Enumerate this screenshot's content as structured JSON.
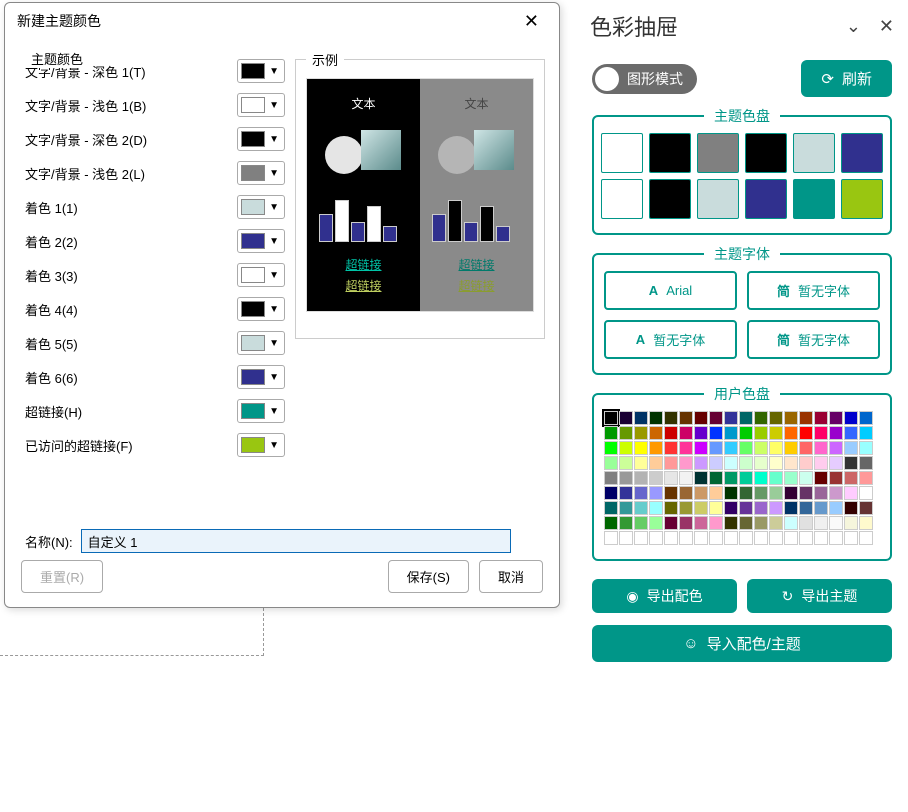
{
  "dialog": {
    "title": "新建主题颜色",
    "group_theme": "主题颜色",
    "group_sample": "示例",
    "rows": [
      {
        "label": "文字/背景 - 深色 1(T)",
        "color": "#000000"
      },
      {
        "label": "文字/背景 - 浅色 1(B)",
        "color": "#FFFFFF"
      },
      {
        "label": "文字/背景 - 深色 2(D)",
        "color": "#000000"
      },
      {
        "label": "文字/背景 - 浅色 2(L)",
        "color": "#808080"
      },
      {
        "label": "着色 1(1)",
        "color": "#C9DCDC"
      },
      {
        "label": "着色 2(2)",
        "color": "#30308E"
      },
      {
        "label": "着色 3(3)",
        "color": "#FFFFFF"
      },
      {
        "label": "着色 4(4)",
        "color": "#000000"
      },
      {
        "label": "着色 5(5)",
        "color": "#C9DCDC"
      },
      {
        "label": "着色 6(6)",
        "color": "#30308E"
      },
      {
        "label": "超链接(H)",
        "color": "#009688"
      },
      {
        "label": "已访问的超链接(F)",
        "color": "#99C611"
      }
    ],
    "sample_text": "文本",
    "sample_link1": "超链接",
    "sample_link2": "超链接",
    "name_label": "名称(N):",
    "name_value": "自定义 1",
    "reset": "重置(R)",
    "save": "保存(S)",
    "cancel": "取消"
  },
  "drawer": {
    "title": "色彩抽屉",
    "mode_label": "图形模式",
    "refresh": "刷新",
    "section_theme": "主题色盘",
    "section_font": "主题字体",
    "section_user": "用户色盘",
    "fonts": [
      "Arial",
      "暂无字体",
      "暂无字体",
      "暂无字体"
    ],
    "theme_colors": [
      "#FFFFFF",
      "#000000",
      "#808080",
      "#000000",
      "#C9DCDC",
      "#30308E",
      "#FFFFFF",
      "#000000",
      "#C9DCDC",
      "#30308E",
      "#009688",
      "#99C611"
    ],
    "user_palette": [
      "#000000",
      "#1a0033",
      "#003366",
      "#003300",
      "#333300",
      "#663300",
      "#660000",
      "#660033",
      "#333399",
      "#006666",
      "#336600",
      "#666600",
      "#996600",
      "#993300",
      "#990033",
      "#660066",
      "#0000cc",
      "#0066cc",
      "#009900",
      "#669900",
      "#999900",
      "#cc6600",
      "#cc0000",
      "#cc0066",
      "#6600cc",
      "#0033ff",
      "#0099cc",
      "#00cc00",
      "#99cc00",
      "#cccc00",
      "#ff6600",
      "#ff0000",
      "#ff0066",
      "#9900cc",
      "#3366ff",
      "#00ccff",
      "#00ff00",
      "#ccff00",
      "#ffff00",
      "#ff9900",
      "#ff3333",
      "#ff3399",
      "#cc00ff",
      "#6699ff",
      "#33ccff",
      "#66ff66",
      "#ccff66",
      "#ffff66",
      "#ffcc00",
      "#ff6666",
      "#ff66cc",
      "#cc66ff",
      "#99ccff",
      "#99ffff",
      "#99ff99",
      "#ccff99",
      "#ffff99",
      "#ffcc99",
      "#ff9999",
      "#ff99cc",
      "#cc99ff",
      "#ccccff",
      "#ccffff",
      "#ccffcc",
      "#e6ffcc",
      "#ffffcc",
      "#ffe6cc",
      "#ffcccc",
      "#ffccee",
      "#e6ccff",
      "#333333",
      "#666666",
      "#808080",
      "#999999",
      "#b3b3b3",
      "#cccccc",
      "#e6e6e6",
      "#f2f2f2",
      "#003333",
      "#006633",
      "#009966",
      "#00cc99",
      "#00ffcc",
      "#66ffcc",
      "#99ffcc",
      "#ccffee",
      "#660000",
      "#993333",
      "#cc6666",
      "#ff9999",
      "#000066",
      "#333399",
      "#6666cc",
      "#9999ff",
      "#663300",
      "#996633",
      "#cc9966",
      "#ffcc99",
      "#003300",
      "#336633",
      "#669966",
      "#99cc99",
      "#330033",
      "#663366",
      "#996699",
      "#cc99cc",
      "#ffccff",
      "#ffffff",
      "#006666",
      "#339999",
      "#66cccc",
      "#99ffff",
      "#666600",
      "#999933",
      "#cccc66",
      "#ffff99",
      "#330066",
      "#663399",
      "#9966cc",
      "#cc99ff",
      "#003366",
      "#336699",
      "#6699cc",
      "#99ccff",
      "#330000",
      "#663333",
      "#006600",
      "#339933",
      "#66cc66",
      "#99ff99",
      "#660033",
      "#993366",
      "#cc6699",
      "#ff99cc",
      "#333300",
      "#666633",
      "#999966",
      "#cccc99",
      "#ccffff",
      "#e0e0e0",
      "#f0f0f0",
      "#fafafa",
      "#f5f5dc",
      "#fffacd",
      "#ffffff",
      "#ffffff",
      "#ffffff",
      "#ffffff",
      "#ffffff",
      "#ffffff",
      "#ffffff",
      "#ffffff",
      "#ffffff",
      "#ffffff",
      "#ffffff",
      "#ffffff",
      "#ffffff",
      "#ffffff",
      "#ffffff",
      "#ffffff",
      "#ffffff",
      "#ffffff"
    ],
    "export_scheme": "导出配色",
    "export_theme": "导出主题",
    "import_scheme": "导入配色/主题"
  }
}
